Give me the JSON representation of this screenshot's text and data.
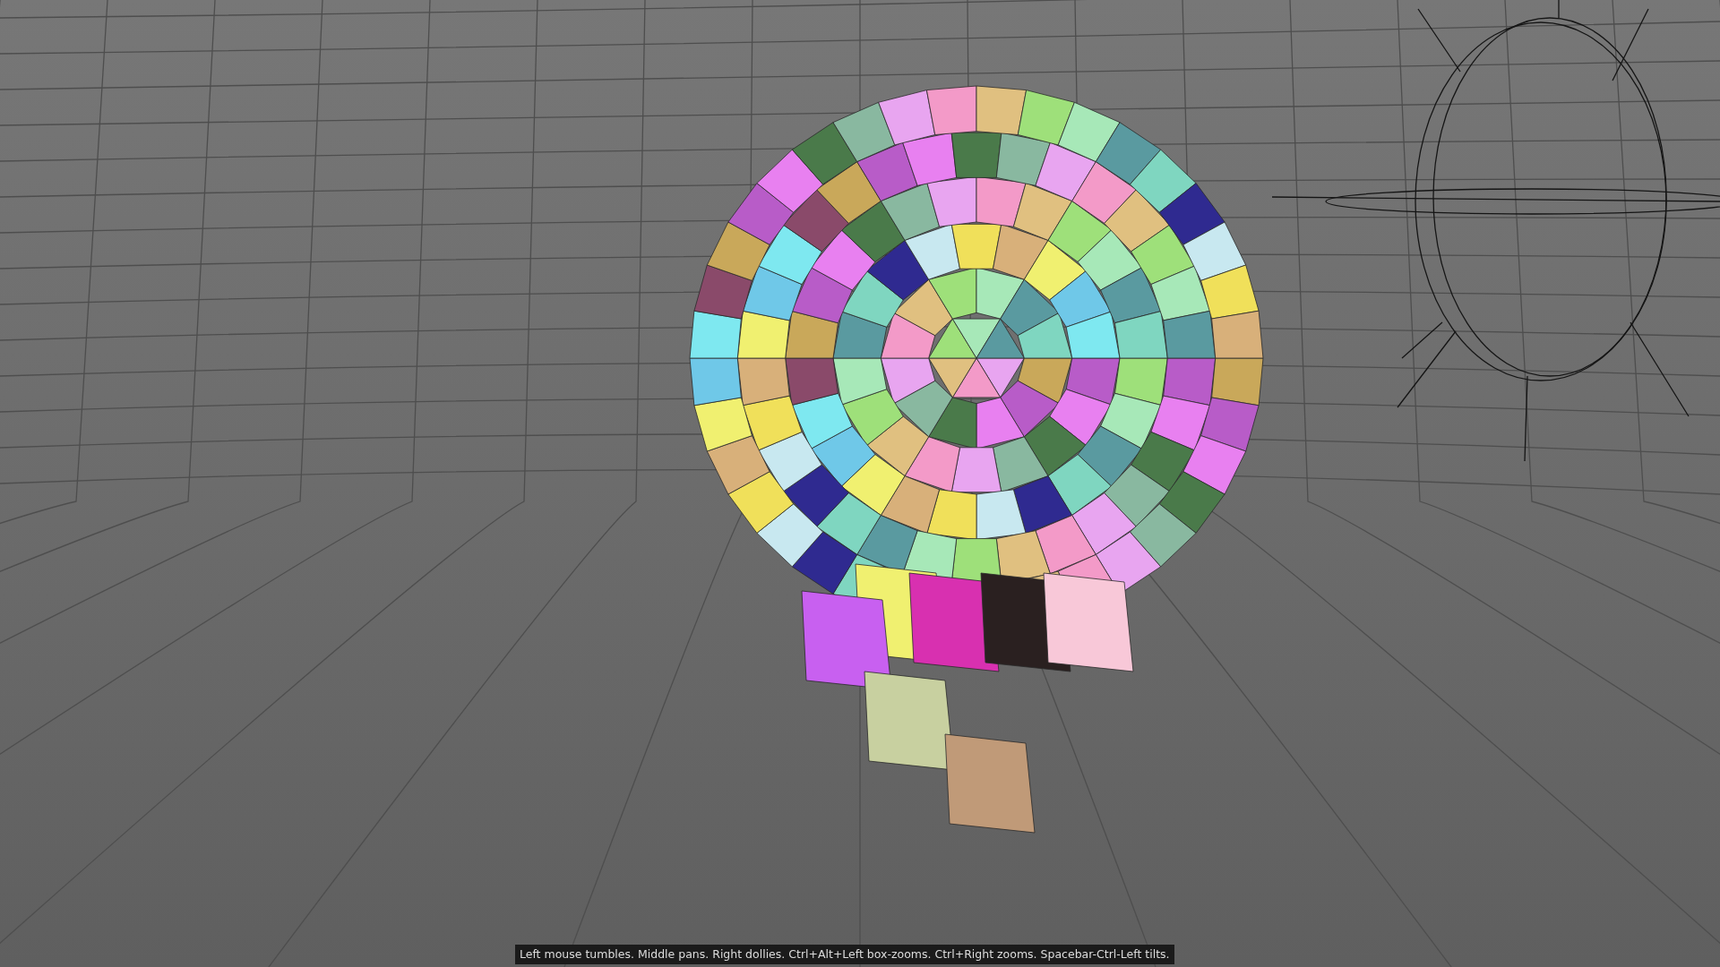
{
  "viewport": {
    "help_line": "Left mouse tumbles. Middle pans. Right dollies. Ctrl+Alt+Left box-zooms. Ctrl+Right zooms. Spacebar-Ctrl-Left tilts."
  }
}
